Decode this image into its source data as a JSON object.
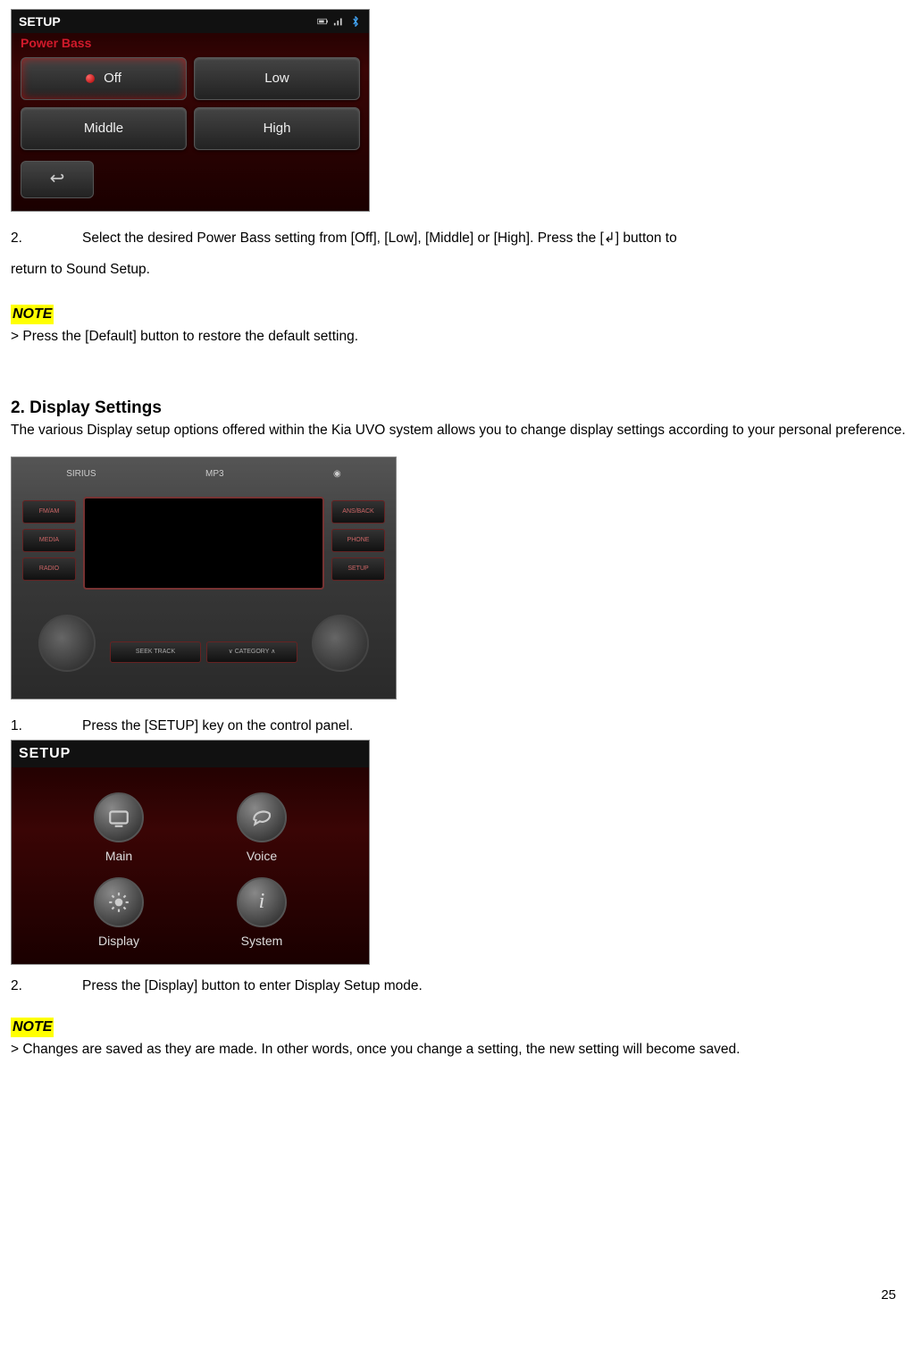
{
  "screen1": {
    "header_title": "SETUP",
    "sub_title": "Power Bass",
    "options": {
      "off": "Off",
      "low": "Low",
      "middle": "Middle",
      "high": "High"
    },
    "back_icon_glyph": "↩"
  },
  "instruction1": {
    "num": "2.",
    "text_a": "Select the desired Power Bass setting from [Off], [Low], [Middle] or [High]. Press the [↲] button to",
    "text_b": "return to Sound Setup."
  },
  "note1": {
    "label": "NOTE",
    "body": "> Press the [Default] button to restore the default setting."
  },
  "section2": {
    "heading": "2. Display Settings",
    "desc": "The various Display setup options offered within the Kia UVO system allows you to change display settings according to your personal preference."
  },
  "radio": {
    "top1": "SIRIUS",
    "top2": "MP3",
    "left_btns": [
      "FM/AM",
      "MEDIA",
      "RADIO"
    ],
    "right_btns": [
      "ANS/BACK",
      "PHONE",
      "SETUP"
    ],
    "bottom_btns": [
      "SEEK TRACK",
      "∨ CATEGORY ∧"
    ]
  },
  "instruction2": {
    "num": "1.",
    "text": "Press the [SETUP] key on the control panel."
  },
  "screen3": {
    "header_title": "SETUP",
    "items": {
      "main": "Main",
      "voice": "Voice",
      "display": "Display",
      "system": "System"
    },
    "info_glyph": "i"
  },
  "instruction3": {
    "num": "2.",
    "text": "Press the [Display] button to enter Display Setup mode."
  },
  "note2": {
    "label": "NOTE",
    "body": "> Changes are saved as they are made. In other words, once you change a setting, the new setting will become saved."
  },
  "page_number": "25"
}
